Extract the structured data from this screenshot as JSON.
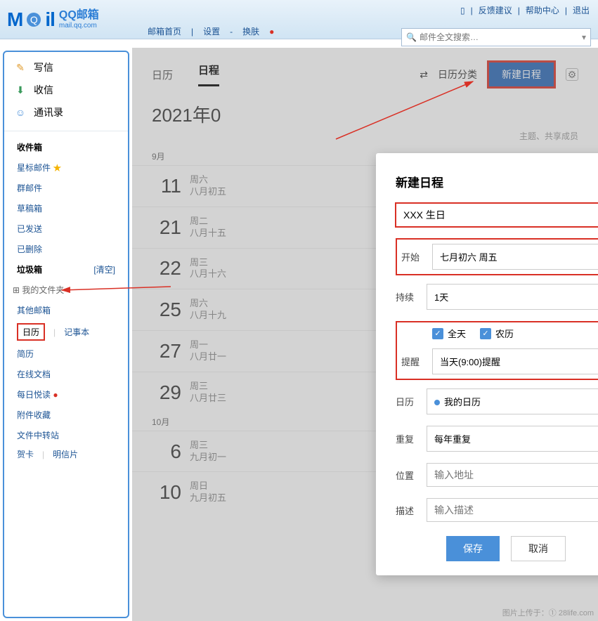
{
  "header": {
    "brand_prefix": "M",
    "brand_suffix": "il",
    "brand_qq": "QQ邮箱",
    "brand_domain": "mail.qq.com",
    "top_links": {
      "feedback": "反馈建议",
      "help": "帮助中心",
      "logout": "退出"
    },
    "subnav": {
      "home": "邮箱首页",
      "settings": "设置",
      "skin": "换肤"
    },
    "search_placeholder": "邮件全文搜索…"
  },
  "sidebar": {
    "compose": "写信",
    "receive": "收信",
    "contacts": "通讯录",
    "inbox": "收件箱",
    "star": "星标邮件",
    "group": "群邮件",
    "drafts": "草稿箱",
    "sent": "已发送",
    "deleted": "已删除",
    "trash": "垃圾箱",
    "clear": "[清空]",
    "my_folders": "我的文件夹",
    "other_mail": "其他邮箱",
    "calendar": "日历",
    "notes": "记事本",
    "resume": "简历",
    "online_doc": "在线文档",
    "daily_read": "每日悦读",
    "attach_fav": "附件收藏",
    "file_transfer": "文件中转站",
    "card": "贺卡",
    "postcard": "明信片"
  },
  "content": {
    "tab_calendar": "日历",
    "tab_schedule": "日程",
    "cal_sort": "日历分类",
    "new_event": "新建日程",
    "title": "2021年0",
    "sub_hint": "主题、共享成员",
    "month1": "9月",
    "month2": "10月",
    "events": [
      {
        "day": "11",
        "dow": "周六",
        "lunar": "八月初五"
      },
      {
        "day": "21",
        "dow": "周二",
        "lunar": "八月十五"
      },
      {
        "day": "22",
        "dow": "周三",
        "lunar": "八月十六"
      },
      {
        "day": "25",
        "dow": "周六",
        "lunar": "八月十九"
      },
      {
        "day": "27",
        "dow": "周一",
        "lunar": "八月廿一"
      },
      {
        "day": "29",
        "dow": "周三",
        "lunar": "八月廿三"
      },
      {
        "day": "6",
        "dow": "周三",
        "lunar": "九月初一"
      },
      {
        "day": "10",
        "dow": "周日",
        "lunar": "九月初五"
      }
    ]
  },
  "dialog": {
    "title": "新建日程",
    "event_value": "XXX 生日",
    "label_start": "开始",
    "start_value": "七月初六 周五",
    "label_duration": "持续",
    "duration_value": "1天",
    "chk_allday": "全天",
    "chk_lunar": "农历",
    "label_remind": "提醒",
    "remind_value": "当天(9:00)提醒",
    "label_calendar": "日历",
    "calendar_value": "我的日历",
    "label_repeat": "重复",
    "repeat_value": "每年重复",
    "label_location": "位置",
    "location_placeholder": "输入地址",
    "label_desc": "描述",
    "desc_placeholder": "输入描述",
    "btn_save": "保存",
    "btn_cancel": "取消"
  },
  "watermark": "图片上传于：① 28life.com"
}
